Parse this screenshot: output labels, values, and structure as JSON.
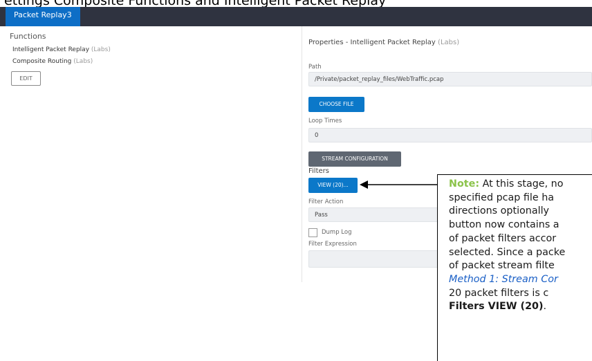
{
  "caption": "ettings Composite Functions and Intelligent Packet Replay",
  "app": {
    "tab": "Packet Replay3"
  },
  "functions": {
    "title": "Functions",
    "items": [
      {
        "name": "Intelligent Packet Replay",
        "tag": "(Labs)"
      },
      {
        "name": "Composite Routing",
        "tag": "(Labs)"
      }
    ],
    "edit_label": "EDIT"
  },
  "properties": {
    "title_prefix": "Properties  - Intelligent Packet Replay",
    "title_tag": "(Labs)",
    "path_label": "Path",
    "path_value": "/Private/packet_replay_files/WebTraffic.pcap",
    "choose_file_label": "CHOOSE FILE",
    "loop_label": "Loop Times",
    "loop_value": "0",
    "stream_config_label": "STREAM CONFIGURATION",
    "filters_label": "Filters",
    "view_label": "VIEW (20)...",
    "filter_action_label": "Filter Action",
    "filter_action_value": "Pass",
    "dump_log_label": "Dump Log",
    "dump_log_checked": false,
    "filter_expression_label": "Filter Expression",
    "filter_expression_value": ""
  },
  "note": {
    "keyword": "Note:",
    "line1": "At this stage, no",
    "line2": "specified pcap file ha",
    "line3": "directions  optionally",
    "line4": "button now contains a",
    "line5": "of packet filters accor",
    "line6": "selected. Since a packe",
    "line7": "of packet stream filte",
    "link": "Method 1: Stream Cor",
    "line9": "20 packet filters is c",
    "line10_bold": "Filters VIEW (20)",
    "line10_end": "."
  },
  "colors": {
    "topbar": "#2f3340",
    "tab": "#0d6ec6",
    "primary_button": "#0b78c9",
    "secondary_button": "#5f6772",
    "note_keyword": "#8bc34a"
  }
}
